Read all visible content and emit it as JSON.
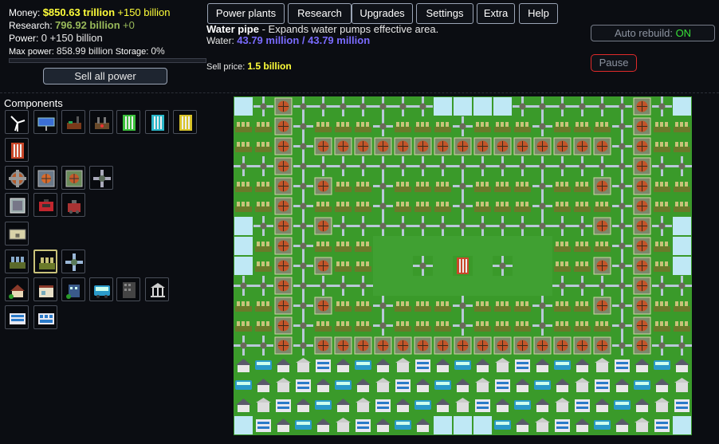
{
  "stats": {
    "money_label": "Money:",
    "money_value": "$850.63 trillion",
    "money_delta": "+150 billion",
    "research_label": "Research:",
    "research_value": "796.92 billion",
    "research_delta": "+0",
    "power_label": "Power:",
    "power_value": "0 +150 billion",
    "maxpower_label": "Max power:",
    "maxpower_value": "858.99 billion",
    "storage_label": "Storage:",
    "storage_value": "0%",
    "storage_fraction": 0.0
  },
  "sell_all_label": "Sell all power",
  "menu": [
    "Power plants",
    "Research",
    "Upgrades",
    "Settings",
    "Extra",
    "Help"
  ],
  "info": {
    "title": "Water pipe",
    "description": " - Expands water pumps effective area.",
    "water_label": "Water:",
    "water_value": "43.79 million / 43.79 million",
    "sell_label": "Sell price:",
    "sell_value": "1.5 billion"
  },
  "auto_rebuild": {
    "label": "Auto rebuild:",
    "state": "ON"
  },
  "pause_label": "Pause",
  "components_title": "Components",
  "components": [
    {
      "icon": "wind-turbine-icon",
      "selected": false
    },
    {
      "icon": "solar-panel-icon",
      "selected": false
    },
    {
      "icon": "coal-plant-icon",
      "selected": false
    },
    {
      "icon": "gas-plant-icon",
      "selected": false
    },
    {
      "icon": "green-cell-icon",
      "selected": false
    },
    {
      "icon": "cyan-cell-icon",
      "selected": false
    },
    {
      "icon": "yellow-cell-icon",
      "selected": false
    },
    {
      "icon": "red-cell-icon",
      "selected": false
    },
    {
      "icon": "heat-exchanger-icon",
      "selected": false
    },
    {
      "icon": "heat-vent-icon",
      "selected": false
    },
    {
      "icon": "cooling-vent-icon",
      "selected": false
    },
    {
      "icon": "heat-pipe-icon",
      "selected": false
    },
    {
      "icon": "insulation-plate-icon",
      "selected": false
    },
    {
      "icon": "red-battery-icon",
      "selected": false
    },
    {
      "icon": "generator-icon",
      "selected": false
    },
    {
      "icon": "metal-plate-icon",
      "selected": false
    },
    {
      "icon": "water-pump-icon",
      "selected": false
    },
    {
      "icon": "water-tank-icon",
      "selected": true
    },
    {
      "icon": "water-pipe-icon",
      "selected": false
    },
    {
      "icon": "small-house-icon",
      "selected": false
    },
    {
      "icon": "shop-icon",
      "selected": false
    },
    {
      "icon": "office-icon",
      "selected": false
    },
    {
      "icon": "bus-icon",
      "selected": false
    },
    {
      "icon": "tower-icon",
      "selected": false
    },
    {
      "icon": "bank-icon",
      "selected": false
    },
    {
      "icon": "apartment-icon",
      "selected": false
    },
    {
      "icon": "mall-icon",
      "selected": false
    }
  ],
  "colors": {
    "money": "#ffff3a",
    "research": "#98b95a",
    "water_value": "#7a6bff",
    "grass": "#3a8f2a",
    "water": "#bfe8f5",
    "auto_on": "#38e038",
    "pause_border": "#e02a2a"
  }
}
